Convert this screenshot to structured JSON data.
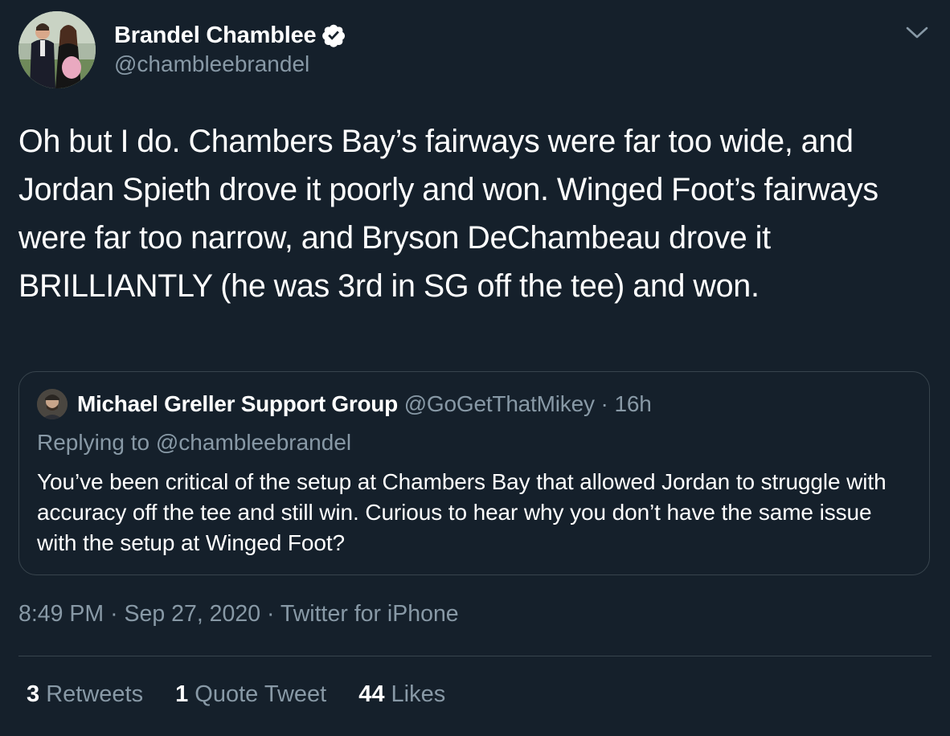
{
  "tweet": {
    "author": {
      "name": "Brandel Chamblee",
      "handle": "@chambleebrandel",
      "verified": true
    },
    "text": "Oh but I do. Chambers Bay’s fairways were far too wide, and Jordan Spieth drove it poorly and won. Winged Foot’s fairways were far too narrow, and Bryson DeChambeau drove it BRILLIANTLY (he was 3rd in SG off the tee) and won.",
    "quoted": {
      "name": "Michael Greller Support Group",
      "handle": "@GoGetThatMikey",
      "dot": "·",
      "age": "16h",
      "replying_prefix": "Replying to",
      "replying_handle": "@chambleebrandel",
      "text": "You’ve been critical of the setup at Chambers Bay that allowed Jordan to struggle with accuracy off the tee and still win. Curious to hear why you don’t have the same issue with the setup at Winged Foot?"
    },
    "time": "8:49 PM",
    "dot": "·",
    "date": "Sep 27, 2020",
    "source": "Twitter for iPhone",
    "stats": {
      "retweets_count": "3",
      "retweets_label": "Retweets",
      "quotes_count": "1",
      "quotes_label": "Quote Tweet",
      "likes_count": "44",
      "likes_label": "Likes"
    }
  },
  "icons": {
    "verified": "verified-badge-icon",
    "menu": "chevron-down-icon"
  },
  "colors": {
    "background": "#15202b",
    "text_primary": "#ffffff",
    "text_secondary": "#8899a6",
    "border": "#38444d"
  }
}
